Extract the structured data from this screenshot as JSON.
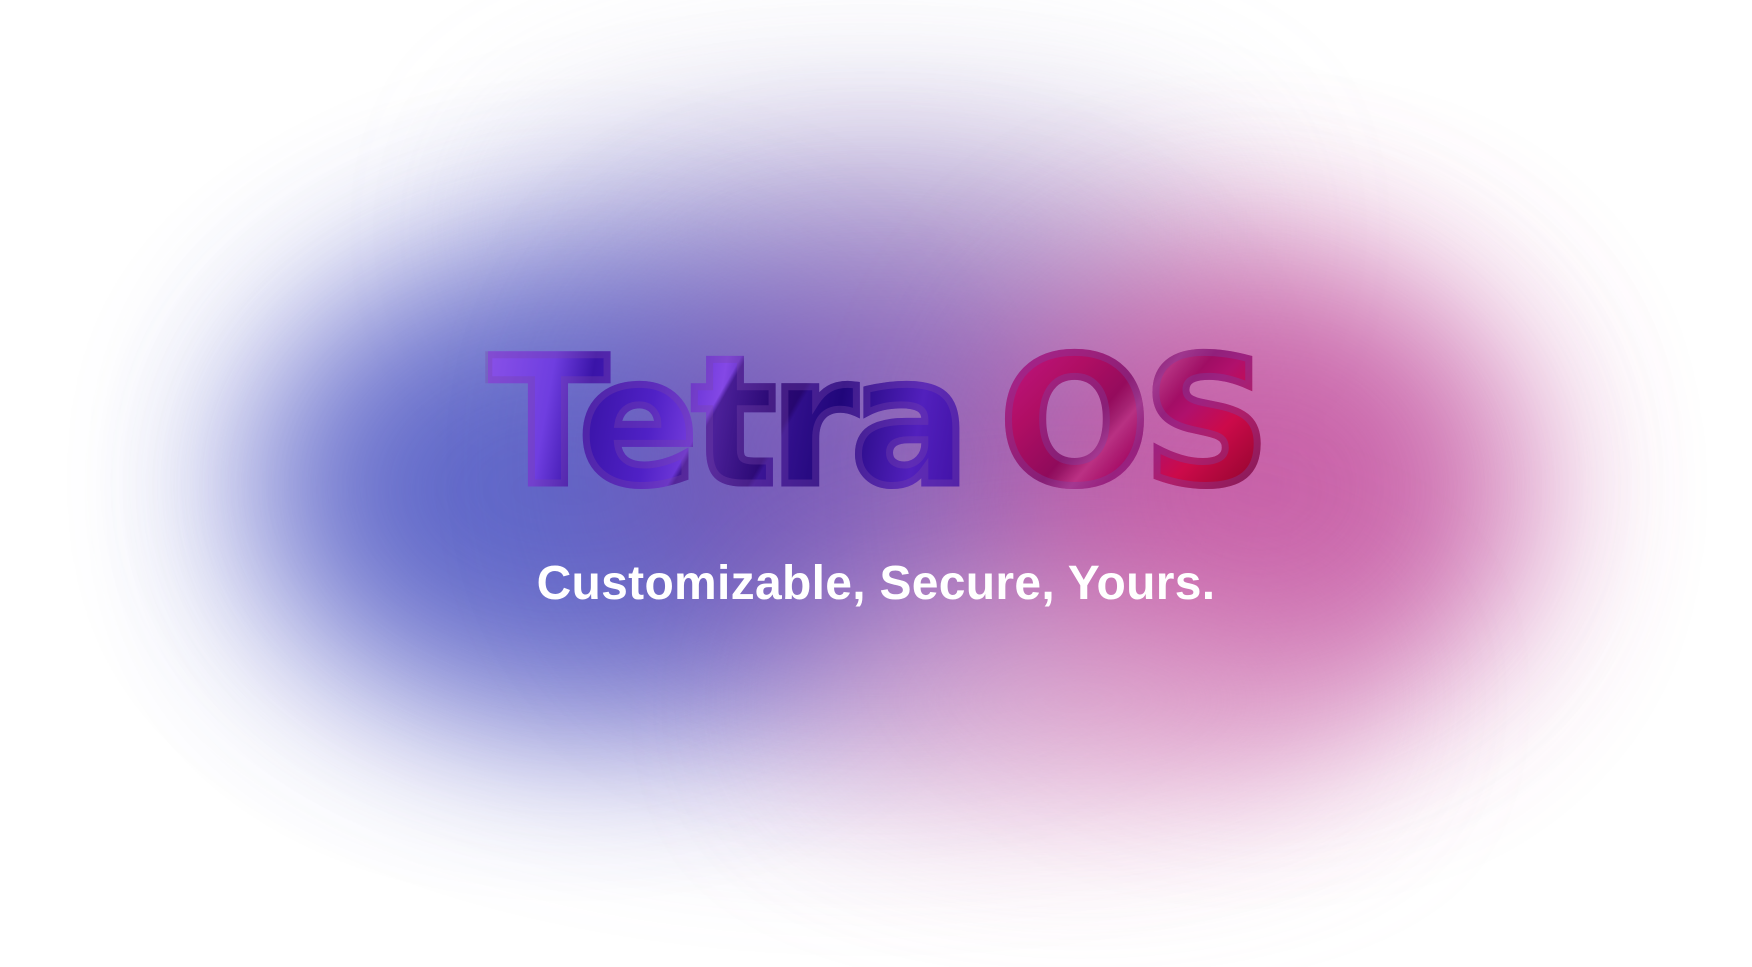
{
  "hero": {
    "title_part1": "Tetra",
    "title_part2": "OS",
    "tagline": "Customizable, Secure, Yours."
  },
  "colors": {
    "background": "#ffffff",
    "glow_left": "#4a55c2",
    "glow_center": "#7a4fb0",
    "glow_right": "#c0479a",
    "title_purple": "#6f3ee0",
    "title_magenta": "#b00e64",
    "tagline": "#ffffff"
  }
}
